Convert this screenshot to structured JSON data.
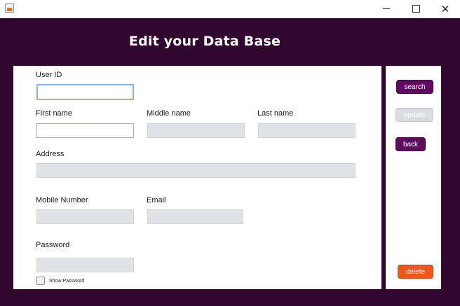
{
  "window": {
    "minimize_glyph": "",
    "close_glyph": "✕"
  },
  "heading": "Edit your Data Base",
  "form": {
    "user_id_label": "User ID",
    "first_name_label": "First name",
    "middle_name_label": "Middle name",
    "last_name_label": "Last name",
    "address_label": "Address",
    "mobile_label": "Mobile Number",
    "email_label": "Email",
    "password_label": "Password",
    "show_password_label": "Show Password",
    "user_id_value": "",
    "first_name_value": "",
    "middle_name_value": "",
    "last_name_value": "",
    "address_value": "",
    "mobile_value": "",
    "email_value": "",
    "password_value": ""
  },
  "actions": {
    "search": "search",
    "update": "update",
    "back": "back",
    "delete": "delete"
  },
  "colors": {
    "frame_background": "#31062f",
    "primary_button": "#5e0b5f",
    "delete_button": "#f0551c",
    "disabled_field": "#dfe2e6"
  }
}
